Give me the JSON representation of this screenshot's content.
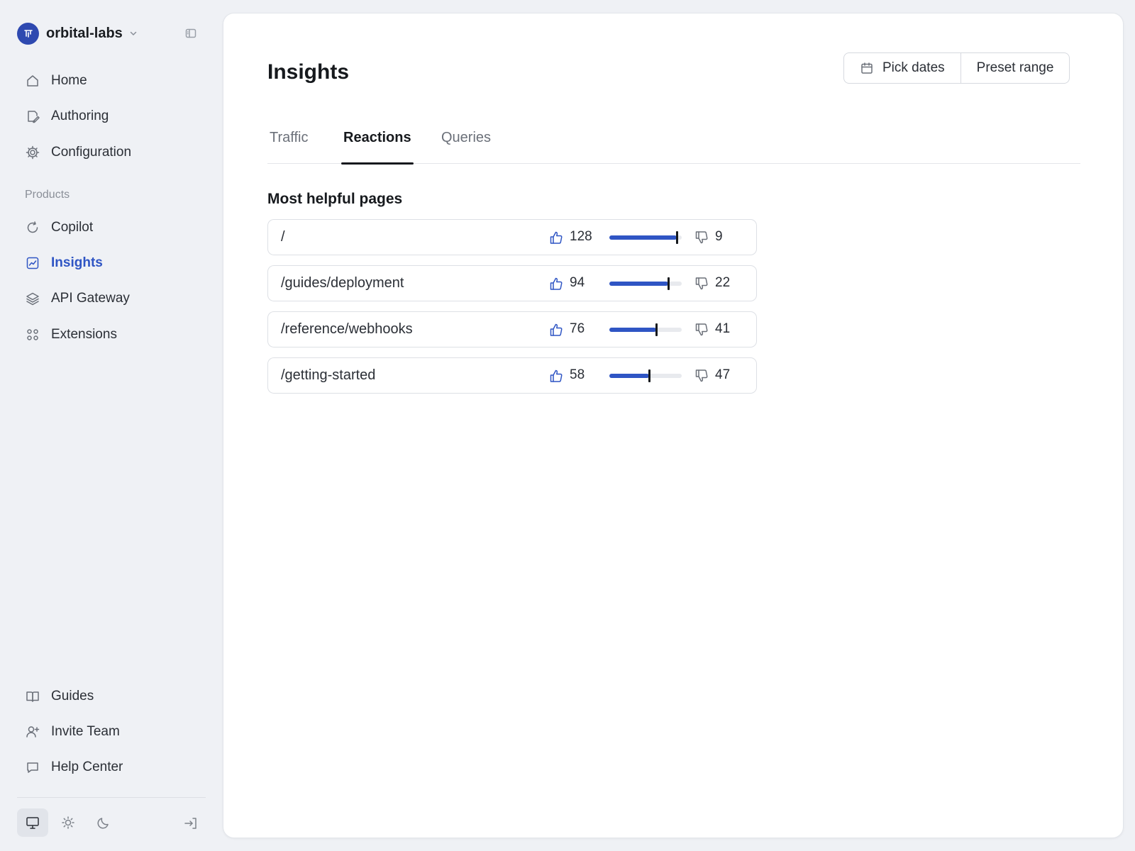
{
  "org": {
    "initials": "⌧",
    "name": "orbital-labs"
  },
  "nav": [
    {
      "label": "Home",
      "icon": "home-icon"
    },
    {
      "label": "Authoring",
      "icon": "edit-icon"
    },
    {
      "label": "Configuration",
      "icon": "gear-icon"
    }
  ],
  "products_label": "Products",
  "products": [
    {
      "label": "Copilot",
      "icon": "refresh-icon"
    },
    {
      "label": "Insights",
      "icon": "chart-icon",
      "active": true
    },
    {
      "label": "API Gateway",
      "icon": "layers-icon"
    },
    {
      "label": "Extensions",
      "icon": "grid-icon"
    }
  ],
  "footer_nav": [
    {
      "label": "Guides",
      "icon": "book-icon"
    },
    {
      "label": "Invite Team",
      "icon": "user-plus-icon"
    },
    {
      "label": "Help Center",
      "icon": "chat-icon"
    }
  ],
  "theme_modes": [
    "system",
    "light",
    "dark"
  ],
  "active_theme": "system",
  "page": {
    "title": "Insights",
    "pick_dates_label": "Pick dates",
    "preset_range_label": "Preset range",
    "tabs": [
      "Traffic",
      "Reactions",
      "Queries"
    ],
    "active_tab": "Reactions",
    "section_title": "Most helpful pages"
  },
  "reactions": [
    {
      "path": "/",
      "up": "128",
      "down": "9",
      "helpful_ratio": 0.93
    },
    {
      "path": "/guides/deployment",
      "up": "94",
      "down": "22",
      "helpful_ratio": 0.81
    },
    {
      "path": "/reference/webhooks",
      "up": "76",
      "down": "41",
      "helpful_ratio": 0.65
    },
    {
      "path": "/getting-started",
      "up": "58",
      "down": "47",
      "helpful_ratio": 0.55
    }
  ],
  "colors": {
    "accent": "#2f55c4",
    "background": "#eff1f5",
    "panel": "#ffffff"
  }
}
